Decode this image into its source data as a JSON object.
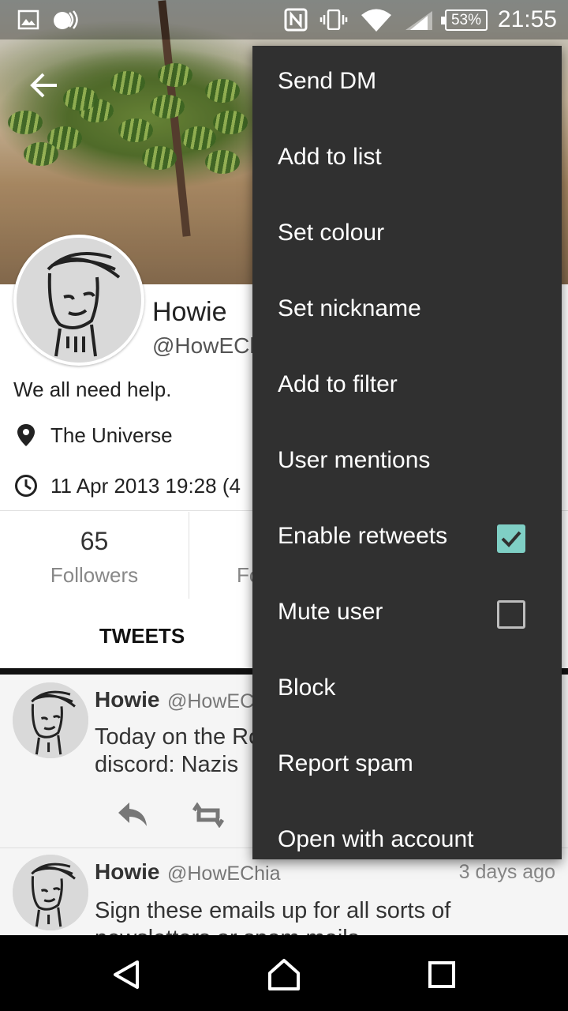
{
  "status_bar": {
    "battery": "53%",
    "time": "21:55"
  },
  "profile": {
    "name": "Howie",
    "handle": "@HowECh",
    "bio": "We all need help.",
    "location": "The Universe",
    "joined": "11 Apr 2013 19:28 (4",
    "followers_count": "65",
    "followers_label": "Followers",
    "following_label": "Fo"
  },
  "tabs": {
    "tweets": "TWEETS"
  },
  "tweets": [
    {
      "name": "Howie",
      "handle": "@HowECh",
      "time": "",
      "text": "Today on the Ro\ndiscord: Nazis"
    },
    {
      "name": "Howie",
      "handle": "@HowEChia",
      "time": "3 days ago",
      "text": "Sign these emails up for all sorts of\nnewsletters or spam mails"
    }
  ],
  "menu": {
    "items": [
      {
        "label": "Send DM"
      },
      {
        "label": "Add to list"
      },
      {
        "label": "Set colour"
      },
      {
        "label": "Set nickname"
      },
      {
        "label": "Add to filter"
      },
      {
        "label": "User mentions"
      },
      {
        "label": "Enable retweets",
        "checked": true
      },
      {
        "label": "Mute user",
        "checked": false
      },
      {
        "label": "Block"
      },
      {
        "label": "Report spam"
      },
      {
        "label": "Open with account"
      }
    ]
  },
  "colors": {
    "menu_bg": "#303030",
    "checkbox_accent": "#7fcfc5"
  }
}
